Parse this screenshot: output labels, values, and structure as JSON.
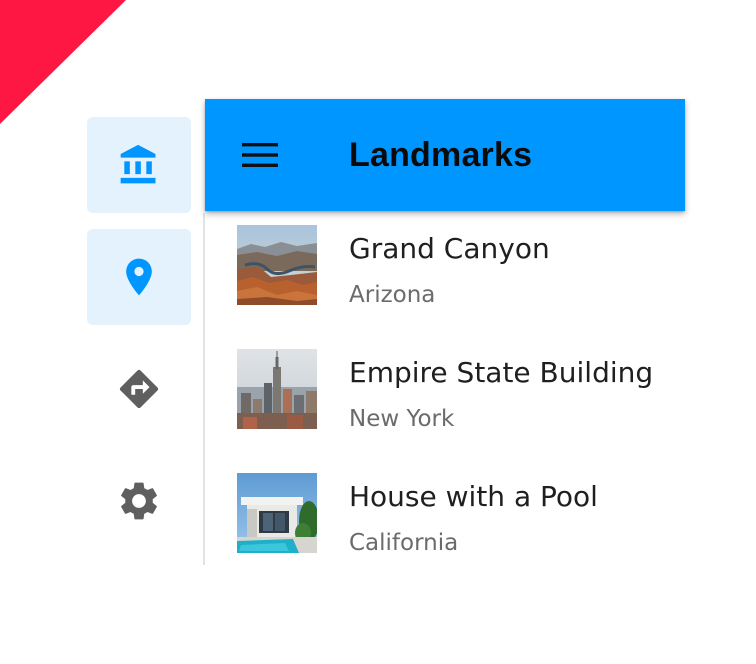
{
  "colors": {
    "accent": "#0096ff",
    "rail_selected_bg": "#e3f2fd",
    "corner_ribbon": "#ff1744",
    "inactive_icon": "#5f5f5f"
  },
  "rail": {
    "items": [
      {
        "icon": "bank-icon",
        "selected": true
      },
      {
        "icon": "location-pin-icon",
        "selected": true
      },
      {
        "icon": "directions-icon",
        "selected": false
      },
      {
        "icon": "gear-icon",
        "selected": false
      }
    ]
  },
  "appbar": {
    "menu_icon": "menu-icon",
    "title": "Landmarks"
  },
  "list": {
    "items": [
      {
        "title": "Grand Canyon",
        "subtitle": "Arizona",
        "thumbnail": "canyon-photo"
      },
      {
        "title": "Empire State Building",
        "subtitle": "New York",
        "thumbnail": "skyline-photo"
      },
      {
        "title": "House with a Pool",
        "subtitle": "California",
        "thumbnail": "house-photo"
      }
    ]
  }
}
